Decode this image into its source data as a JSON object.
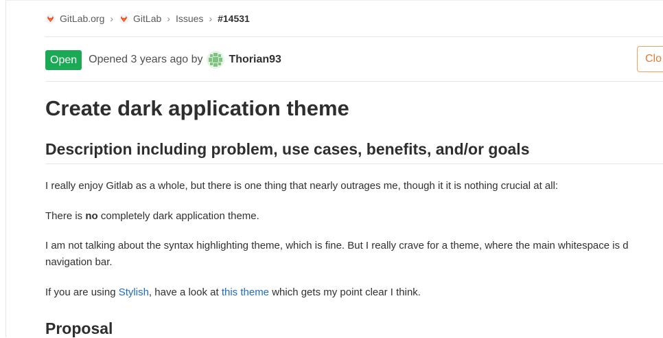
{
  "breadcrumb": {
    "items": [
      {
        "label": "GitLab.org",
        "icon": "gitlab-tanuki-icon"
      },
      {
        "label": "GitLab",
        "icon": "gitlab-tanuki-icon"
      },
      {
        "label": "Issues"
      },
      {
        "label": "#14531"
      }
    ],
    "separator": "›"
  },
  "issue": {
    "status": "Open",
    "opened_text": "Opened 3 years ago by",
    "author": "Thorian93",
    "close_label": "Clo",
    "title": "Create dark application theme"
  },
  "description": {
    "heading": "Description including problem, use cases, benefits, and/or goals",
    "p1": "I really enjoy Gitlab as a whole, but there is one thing that nearly outrages me, though it it is nothing crucial at all:",
    "p2_before": "There is ",
    "p2_bold": "no",
    "p2_after": " completely dark application theme.",
    "p3_line1": "I am not talking about the syntax highlighting theme, which is fine. But I really crave for a theme, where the main whitespace is d",
    "p3_line2": "navigation bar.",
    "p4_before": "If you are using ",
    "p4_link1": "Stylish",
    "p4_middle": ", have a look at ",
    "p4_link2": "this theme",
    "p4_after": " which gets my point clear I think."
  },
  "proposal": {
    "heading": "Proposal"
  },
  "colors": {
    "status_open": "#1aaa55",
    "close_button": "#e27a2f",
    "link": "#1f6bc2",
    "tanuki": "#e24329"
  }
}
